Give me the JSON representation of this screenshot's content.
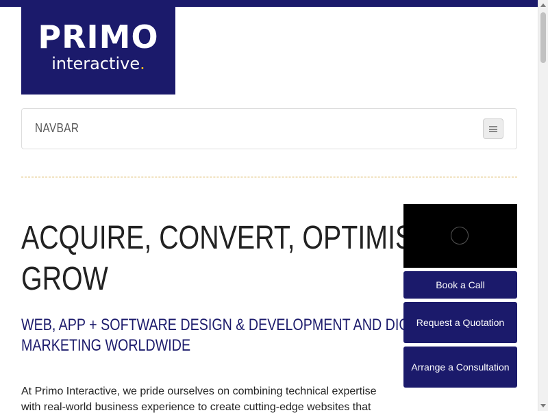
{
  "logo": {
    "primary": "PRIMO",
    "secondary": "interactive",
    "dot": "."
  },
  "navbar": {
    "brand": "NAVBAR"
  },
  "hero": {
    "headline_line1": "ACQUIRE, CONVERT, OPTIMISE,",
    "headline_line2": "GROW",
    "subheadline": "WEB, APP + SOFTWARE DESIGN & DEVELOPMENT AND DIGITAL MARKETING WORLDWIDE",
    "intro": "At Primo Interactive, we pride ourselves on combining technical expertise with real-world business experience to create cutting-edge websites that"
  },
  "sidebar": {
    "buttons": [
      {
        "label": "Book a Call"
      },
      {
        "label": "Request a Quotation"
      },
      {
        "label": "Arrange a Consultation"
      }
    ]
  },
  "colors": {
    "brand": "#1b1a6b",
    "accent": "#e6b422"
  },
  "icons": [
    "menu-icon",
    "play-icon"
  ]
}
